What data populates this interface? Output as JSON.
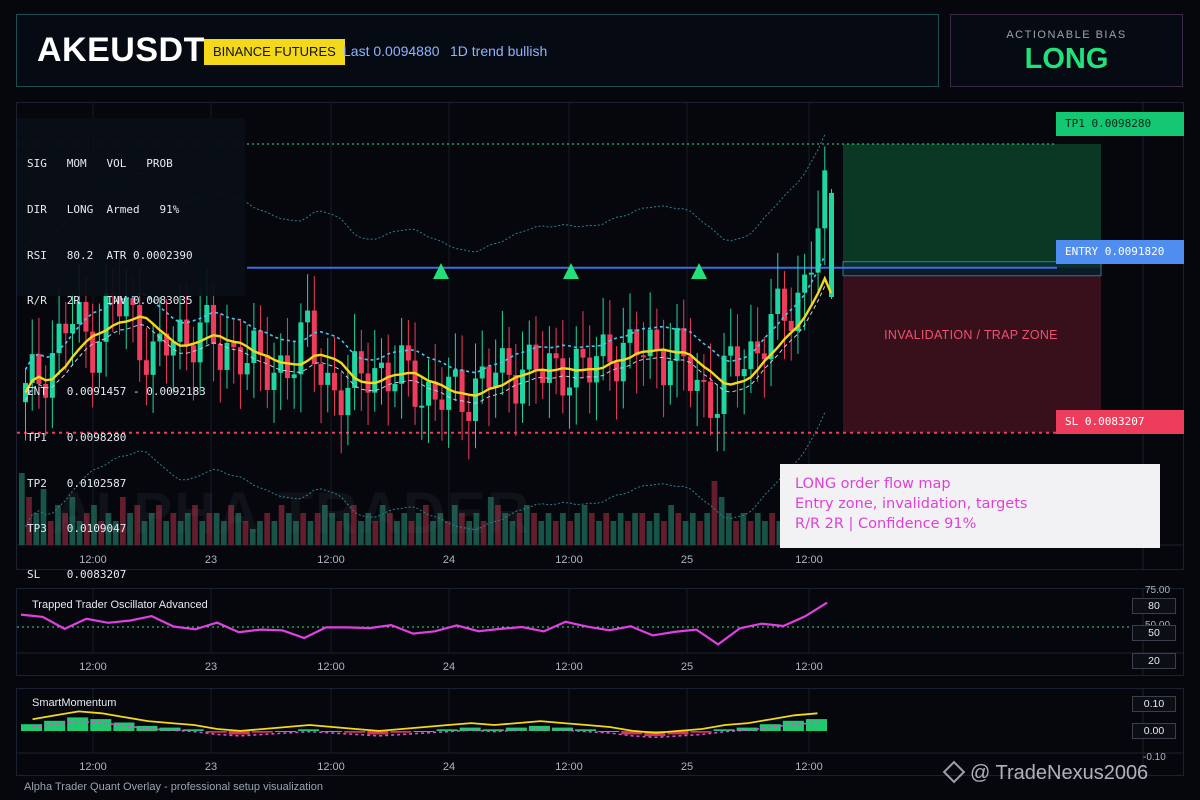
{
  "header": {
    "symbol": "AKEUSDT",
    "exchange": "BINANCE FUTURES",
    "last": "Last 0.0094880",
    "trend": "1D trend bullish"
  },
  "bias": {
    "label": "ACTIONABLE BIAS",
    "value": "LONG"
  },
  "info_panel": [
    "SIG   MOM   VOL   PROB",
    "DIR   LONG  Armed   91%",
    "RSI   80.2  ATR 0.0002390",
    "R/R   2R    INV 0.0083035",
    "",
    "ENT   0.0091457 - 0.0092183",
    "TP1   0.0098280",
    "TP2   0.0102587",
    "TP3   0.0109047",
    "SL    0.0083207"
  ],
  "tags": {
    "tp1": "TP1 0.0098280",
    "entry": "ENTRY 0.0091820",
    "sl": "SL 0.0083207"
  },
  "zone_label": "INVALIDATION / TRAP ZONE",
  "note": {
    "line1": "LONG order flow map",
    "line2": "Entry zone, invalidation, targets",
    "line3": "R/R 2R | Confidence 91%"
  },
  "watermark": "ALPHA TRADER",
  "x_axis_labels": [
    "12:00",
    "23",
    "12:00",
    "24",
    "12:00",
    "25",
    "12:00"
  ],
  "oscillator": {
    "title": "Trapped Trader Oscillator Advanced",
    "axis": {
      "top": "75.00",
      "mid": "50.00"
    },
    "boxes": [
      "80",
      "50",
      "20"
    ]
  },
  "momentum": {
    "title": "SmartMomentum",
    "boxes": [
      "0.10",
      "0.00"
    ],
    "axis_bottom": "-0.10"
  },
  "footer": "Alpha Trader Quant Overlay - professional setup visualization",
  "credit": "@ TradeNexus2006",
  "colors": {
    "bull": "#1fd6a0",
    "bear": "#ee3c5c",
    "accent": "#f4d81a",
    "tp": "#14c873",
    "entry": "#4f8ef0",
    "sl": "#ee3c5c",
    "osc": "#e040e0"
  },
  "chart_data": {
    "type": "candlestick",
    "levels": {
      "tp1": 0.009828,
      "entry": 0.009182,
      "sl": 0.0083207
    },
    "price_series": [
      0.0085,
      0.0087,
      0.0089,
      0.0088,
      0.009,
      0.0089,
      0.0087,
      0.0088,
      0.0089,
      0.0087,
      0.0088,
      0.0086,
      0.0087,
      0.0088,
      0.0086,
      0.0085,
      0.0087,
      0.0086,
      0.0086,
      0.0085,
      0.0085,
      0.0086,
      0.0086,
      0.0087,
      0.0086,
      0.0087,
      0.0086,
      0.0088,
      0.0087,
      0.0088,
      0.0087,
      0.0086,
      0.0085,
      0.0087,
      0.0088,
      0.0089,
      0.0091,
      0.0095
    ],
    "oscillator_series": [
      78,
      74,
      70,
      73,
      71,
      76,
      74,
      70,
      68,
      69,
      67,
      66,
      64,
      63,
      66,
      68,
      70,
      67,
      65,
      66,
      67,
      68,
      66,
      67,
      68,
      70,
      69,
      68,
      66,
      64,
      65,
      64,
      58,
      66,
      70,
      72,
      74,
      88
    ],
    "momentum_series": [
      0.04,
      0.06,
      0.08,
      0.07,
      0.05,
      0.03,
      0.02,
      0.01,
      -0.01,
      -0.02,
      -0.01,
      0.0,
      0.01,
      0.0,
      -0.01,
      -0.02,
      -0.01,
      0.0,
      0.01,
      0.02,
      0.01,
      0.02,
      0.03,
      0.02,
      0.01,
      0.0,
      -0.02,
      -0.03,
      -0.02,
      -0.01,
      0.01,
      0.02,
      0.04,
      0.06,
      0.07
    ]
  }
}
